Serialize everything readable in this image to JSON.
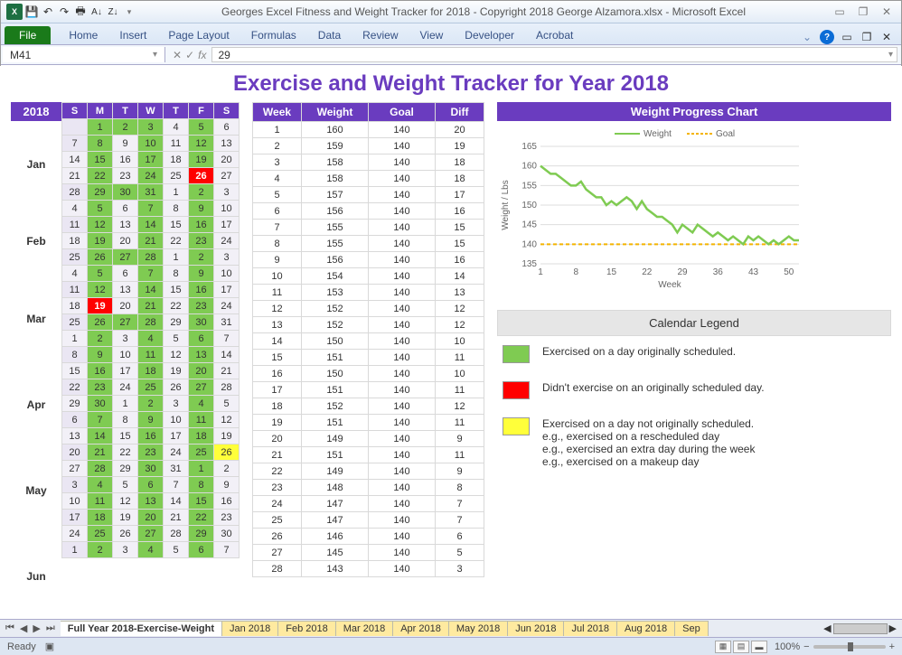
{
  "window": {
    "title": "Georges Excel Fitness and Weight Tracker for 2018 - Copyright 2018 George Alzamora.xlsx  -  Microsoft Excel"
  },
  "ribbon": {
    "file": "File",
    "tabs": [
      "Home",
      "Insert",
      "Page Layout",
      "Formulas",
      "Data",
      "Review",
      "View",
      "Developer",
      "Acrobat"
    ]
  },
  "formula": {
    "cell": "M41",
    "value": "29"
  },
  "title": "Exercise and Weight Tracker for Year 2018",
  "year": "2018",
  "months": [
    "Jan",
    "Feb",
    "Mar",
    "Apr",
    "May",
    "Jun"
  ],
  "dow": [
    "S",
    "M",
    "T",
    "W",
    "T",
    "F",
    "S"
  ],
  "calendar": [
    [
      [
        "",
        "p"
      ],
      [
        "1",
        "g"
      ],
      [
        "2",
        "g"
      ],
      [
        "3",
        "g"
      ],
      [
        "4",
        "li"
      ],
      [
        "5",
        "g"
      ],
      [
        "6",
        "li"
      ]
    ],
    [
      [
        "7",
        "p"
      ],
      [
        "8",
        "g"
      ],
      [
        "9",
        "li"
      ],
      [
        "10",
        "g"
      ],
      [
        "11",
        "li"
      ],
      [
        "12",
        "g"
      ],
      [
        "13",
        "li"
      ]
    ],
    [
      [
        "14",
        "li"
      ],
      [
        "15",
        "g"
      ],
      [
        "16",
        "li"
      ],
      [
        "17",
        "g"
      ],
      [
        "18",
        "li"
      ],
      [
        "19",
        "g"
      ],
      [
        "20",
        "li"
      ]
    ],
    [
      [
        "21",
        "li"
      ],
      [
        "22",
        "g"
      ],
      [
        "23",
        "li"
      ],
      [
        "24",
        "g"
      ],
      [
        "25",
        "li"
      ],
      [
        "26",
        "r"
      ],
      [
        "27",
        "li"
      ]
    ],
    [
      [
        "28",
        "p"
      ],
      [
        "29",
        "g"
      ],
      [
        "30",
        "g"
      ],
      [
        "31",
        "g"
      ],
      [
        "1",
        "li"
      ],
      [
        "2",
        "g"
      ],
      [
        "3",
        "li"
      ]
    ],
    [
      [
        "4",
        "li"
      ],
      [
        "5",
        "g"
      ],
      [
        "6",
        "li"
      ],
      [
        "7",
        "g"
      ],
      [
        "8",
        "li"
      ],
      [
        "9",
        "g"
      ],
      [
        "10",
        "li"
      ]
    ],
    [
      [
        "11",
        "p"
      ],
      [
        "12",
        "g"
      ],
      [
        "13",
        "li"
      ],
      [
        "14",
        "g"
      ],
      [
        "15",
        "li"
      ],
      [
        "16",
        "g"
      ],
      [
        "17",
        "li"
      ]
    ],
    [
      [
        "18",
        "li"
      ],
      [
        "19",
        "g"
      ],
      [
        "20",
        "li"
      ],
      [
        "21",
        "g"
      ],
      [
        "22",
        "li"
      ],
      [
        "23",
        "g"
      ],
      [
        "24",
        "li"
      ]
    ],
    [
      [
        "25",
        "p"
      ],
      [
        "26",
        "g"
      ],
      [
        "27",
        "g"
      ],
      [
        "28",
        "g"
      ],
      [
        "1",
        "li"
      ],
      [
        "2",
        "g"
      ],
      [
        "3",
        "li"
      ]
    ],
    [
      [
        "4",
        "li"
      ],
      [
        "5",
        "g"
      ],
      [
        "6",
        "li"
      ],
      [
        "7",
        "g"
      ],
      [
        "8",
        "li"
      ],
      [
        "9",
        "g"
      ],
      [
        "10",
        "li"
      ]
    ],
    [
      [
        "11",
        "p"
      ],
      [
        "12",
        "g"
      ],
      [
        "13",
        "li"
      ],
      [
        "14",
        "g"
      ],
      [
        "15",
        "li"
      ],
      [
        "16",
        "g"
      ],
      [
        "17",
        "li"
      ]
    ],
    [
      [
        "18",
        "li"
      ],
      [
        "19",
        "r"
      ],
      [
        "20",
        "li"
      ],
      [
        "21",
        "g"
      ],
      [
        "22",
        "li"
      ],
      [
        "23",
        "g"
      ],
      [
        "24",
        "li"
      ]
    ],
    [
      [
        "25",
        "p"
      ],
      [
        "26",
        "g"
      ],
      [
        "27",
        "g"
      ],
      [
        "28",
        "g"
      ],
      [
        "29",
        "li"
      ],
      [
        "30",
        "g"
      ],
      [
        "31",
        "li"
      ]
    ],
    [
      [
        "1",
        "li"
      ],
      [
        "2",
        "g"
      ],
      [
        "3",
        "li"
      ],
      [
        "4",
        "g"
      ],
      [
        "5",
        "li"
      ],
      [
        "6",
        "g"
      ],
      [
        "7",
        "li"
      ]
    ],
    [
      [
        "8",
        "p"
      ],
      [
        "9",
        "g"
      ],
      [
        "10",
        "li"
      ],
      [
        "11",
        "g"
      ],
      [
        "12",
        "li"
      ],
      [
        "13",
        "g"
      ],
      [
        "14",
        "li"
      ]
    ],
    [
      [
        "15",
        "li"
      ],
      [
        "16",
        "g"
      ],
      [
        "17",
        "li"
      ],
      [
        "18",
        "g"
      ],
      [
        "19",
        "li"
      ],
      [
        "20",
        "g"
      ],
      [
        "21",
        "li"
      ]
    ],
    [
      [
        "22",
        "p"
      ],
      [
        "23",
        "g"
      ],
      [
        "24",
        "li"
      ],
      [
        "25",
        "g"
      ],
      [
        "26",
        "li"
      ],
      [
        "27",
        "g"
      ],
      [
        "28",
        "li"
      ]
    ],
    [
      [
        "29",
        "li"
      ],
      [
        "30",
        "g"
      ],
      [
        "1",
        "li"
      ],
      [
        "2",
        "g"
      ],
      [
        "3",
        "li"
      ],
      [
        "4",
        "g"
      ],
      [
        "5",
        "li"
      ]
    ],
    [
      [
        "6",
        "p"
      ],
      [
        "7",
        "g"
      ],
      [
        "8",
        "li"
      ],
      [
        "9",
        "g"
      ],
      [
        "10",
        "li"
      ],
      [
        "11",
        "g"
      ],
      [
        "12",
        "li"
      ]
    ],
    [
      [
        "13",
        "li"
      ],
      [
        "14",
        "g"
      ],
      [
        "15",
        "li"
      ],
      [
        "16",
        "g"
      ],
      [
        "17",
        "li"
      ],
      [
        "18",
        "g"
      ],
      [
        "19",
        "li"
      ]
    ],
    [
      [
        "20",
        "p"
      ],
      [
        "21",
        "g"
      ],
      [
        "22",
        "li"
      ],
      [
        "23",
        "g"
      ],
      [
        "24",
        "li"
      ],
      [
        "25",
        "g"
      ],
      [
        "26",
        "y"
      ]
    ],
    [
      [
        "27",
        "li"
      ],
      [
        "28",
        "g"
      ],
      [
        "29",
        "li"
      ],
      [
        "30",
        "g"
      ],
      [
        "31",
        "li"
      ],
      [
        "1",
        "g"
      ],
      [
        "2",
        "li"
      ]
    ],
    [
      [
        "3",
        "p"
      ],
      [
        "4",
        "g"
      ],
      [
        "5",
        "li"
      ],
      [
        "6",
        "g"
      ],
      [
        "7",
        "li"
      ],
      [
        "8",
        "g"
      ],
      [
        "9",
        "li"
      ]
    ],
    [
      [
        "10",
        "li"
      ],
      [
        "11",
        "g"
      ],
      [
        "12",
        "li"
      ],
      [
        "13",
        "g"
      ],
      [
        "14",
        "li"
      ],
      [
        "15",
        "g"
      ],
      [
        "16",
        "li"
      ]
    ],
    [
      [
        "17",
        "p"
      ],
      [
        "18",
        "g"
      ],
      [
        "19",
        "li"
      ],
      [
        "20",
        "g"
      ],
      [
        "21",
        "li"
      ],
      [
        "22",
        "g"
      ],
      [
        "23",
        "li"
      ]
    ],
    [
      [
        "24",
        "li"
      ],
      [
        "25",
        "g"
      ],
      [
        "26",
        "li"
      ],
      [
        "27",
        "g"
      ],
      [
        "28",
        "li"
      ],
      [
        "29",
        "g"
      ],
      [
        "30",
        "li"
      ]
    ],
    [
      [
        "1",
        "p"
      ],
      [
        "2",
        "g"
      ],
      [
        "3",
        "li"
      ],
      [
        "4",
        "g"
      ],
      [
        "5",
        "li"
      ],
      [
        "6",
        "g"
      ],
      [
        "7",
        "li"
      ]
    ]
  ],
  "wtable": {
    "headers": [
      "Week",
      "Weight",
      "Goal",
      "Diff"
    ],
    "rows": [
      [
        1,
        160,
        140,
        20
      ],
      [
        2,
        159,
        140,
        19
      ],
      [
        3,
        158,
        140,
        18
      ],
      [
        4,
        158,
        140,
        18
      ],
      [
        5,
        157,
        140,
        17
      ],
      [
        6,
        156,
        140,
        16
      ],
      [
        7,
        155,
        140,
        15
      ],
      [
        8,
        155,
        140,
        15
      ],
      [
        9,
        156,
        140,
        16
      ],
      [
        10,
        154,
        140,
        14
      ],
      [
        11,
        153,
        140,
        13
      ],
      [
        12,
        152,
        140,
        12
      ],
      [
        13,
        152,
        140,
        12
      ],
      [
        14,
        150,
        140,
        10
      ],
      [
        15,
        151,
        140,
        11
      ],
      [
        16,
        150,
        140,
        10
      ],
      [
        17,
        151,
        140,
        11
      ],
      [
        18,
        152,
        140,
        12
      ],
      [
        19,
        151,
        140,
        11
      ],
      [
        20,
        149,
        140,
        9
      ],
      [
        21,
        151,
        140,
        11
      ],
      [
        22,
        149,
        140,
        9
      ],
      [
        23,
        148,
        140,
        8
      ],
      [
        24,
        147,
        140,
        7
      ],
      [
        25,
        147,
        140,
        7
      ],
      [
        26,
        146,
        140,
        6
      ],
      [
        27,
        145,
        140,
        5
      ],
      [
        28,
        143,
        140,
        3
      ]
    ]
  },
  "chart": {
    "title": "Weight Progress Chart",
    "legend": [
      "Weight",
      "Goal"
    ],
    "ylabel": "Weight / Lbs",
    "xlabel": "Week",
    "yticks": [
      135,
      140,
      145,
      150,
      155,
      160,
      165
    ],
    "xticks": [
      1,
      8,
      15,
      22,
      29,
      36,
      43,
      50
    ]
  },
  "chart_data": {
    "type": "line",
    "title": "Weight Progress Chart",
    "xlabel": "Week",
    "ylabel": "Weight / Lbs",
    "ylim": [
      135,
      165
    ],
    "series": [
      {
        "name": "Weight",
        "x": [
          1,
          2,
          3,
          4,
          5,
          6,
          7,
          8,
          9,
          10,
          11,
          12,
          13,
          14,
          15,
          16,
          17,
          18,
          19,
          20,
          21,
          22,
          23,
          24,
          25,
          26,
          27,
          28,
          29,
          30,
          31,
          32,
          33,
          34,
          35,
          36,
          37,
          38,
          39,
          40,
          41,
          42,
          43,
          44,
          45,
          46,
          47,
          48,
          49,
          50,
          51,
          52
        ],
        "values": [
          160,
          159,
          158,
          158,
          157,
          156,
          155,
          155,
          156,
          154,
          153,
          152,
          152,
          150,
          151,
          150,
          151,
          152,
          151,
          149,
          151,
          149,
          148,
          147,
          147,
          146,
          145,
          143,
          145,
          144,
          143,
          145,
          144,
          143,
          142,
          143,
          142,
          141,
          142,
          141,
          140,
          142,
          141,
          142,
          141,
          140,
          141,
          140,
          141,
          142,
          141,
          141
        ]
      },
      {
        "name": "Goal",
        "x": [
          1,
          52
        ],
        "values": [
          140,
          140
        ]
      }
    ]
  },
  "legend_box": {
    "title": "Calendar Legend",
    "items": [
      {
        "color": "#7fcb52",
        "text": "Exercised on a day originally scheduled."
      },
      {
        "color": "#f00",
        "text": "Didn't exercise on an originally scheduled day."
      },
      {
        "color": "#ffff3a",
        "text": "Exercised on a day not originally scheduled.\ne.g., exercised on a rescheduled day\ne.g., exercised an extra day during the week\ne.g., exercised on a makeup day"
      }
    ]
  },
  "tabs": [
    "Full Year 2018-Exercise-Weight",
    "Jan 2018",
    "Feb 2018",
    "Mar 2018",
    "Apr 2018",
    "May 2018",
    "Jun 2018",
    "Jul 2018",
    "Aug 2018",
    "Sep"
  ],
  "status": {
    "ready": "Ready",
    "zoom": "100%"
  }
}
